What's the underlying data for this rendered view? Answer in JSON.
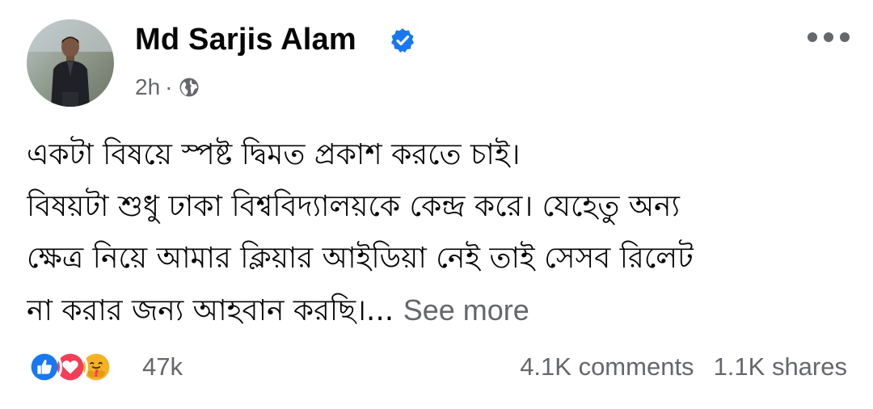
{
  "post": {
    "author": "Md Sarjis Alam",
    "time": "2h",
    "separator": "·",
    "privacy_icon": "globe-icon",
    "verified_icon": "verified-badge-icon",
    "more_icon": "more-options-icon",
    "body_lines": [
      "একটা বিষয়ে স্পষ্ট দ্বিমত প্রকাশ করতে চাই।",
      "বিষয়টা শুধু ঢাকা বিশ্ববিদ্যালয়কে কেন্দ্র করে। যেহেতু অন্য",
      "ক্ষেত্র নিয়ে আমার ক্লিয়ার আইডিয়া নেই তাই সেসব রিলেট",
      "না করার জন্য আহবান করছি।..."
    ],
    "see_more": "See more"
  },
  "engagement": {
    "reactions": [
      "like-icon",
      "love-icon",
      "care-icon"
    ],
    "reaction_count": "47k",
    "comments": "4.1K comments",
    "shares": "1.1K shares"
  },
  "colors": {
    "text": "#050505",
    "secondary_text": "#65676b",
    "facebook_blue": "#1877f2",
    "love_red": "#f33e58",
    "care_yellow": "#f7b125"
  }
}
